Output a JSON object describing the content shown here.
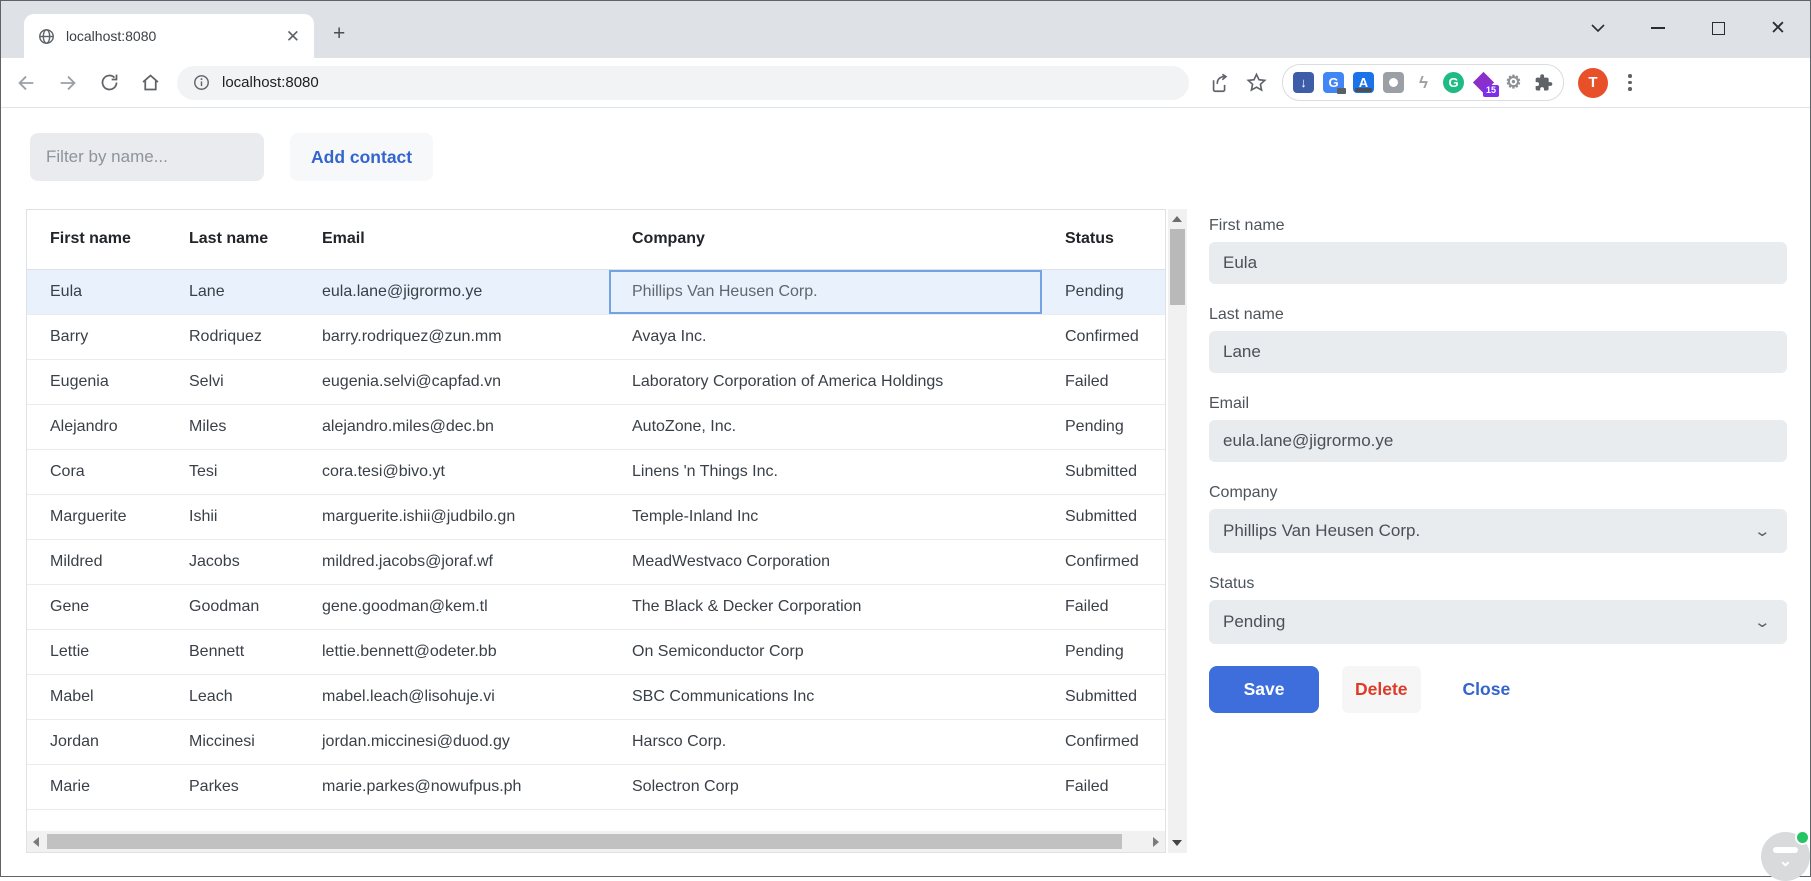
{
  "browser": {
    "tab_title": "localhost:8080",
    "url": "localhost:8080",
    "extensions_badge": "15",
    "avatar_letter": "T"
  },
  "actions": {
    "filter_placeholder": "Filter by name...",
    "add_contact": "Add contact"
  },
  "table": {
    "columns": [
      "First name",
      "Last name",
      "Email",
      "Company",
      "Status"
    ],
    "selected_row_index": 0,
    "focused_cell": {
      "row": 0,
      "column": "company"
    },
    "rows": [
      {
        "first": "Eula",
        "last": "Lane",
        "email": "eula.lane@jigrormo.ye",
        "company": "Phillips Van Heusen Corp.",
        "status": "Pending"
      },
      {
        "first": "Barry",
        "last": "Rodriquez",
        "email": "barry.rodriquez@zun.mm",
        "company": "Avaya Inc.",
        "status": "Confirmed"
      },
      {
        "first": "Eugenia",
        "last": "Selvi",
        "email": "eugenia.selvi@capfad.vn",
        "company": "Laboratory Corporation of America Holdings",
        "status": "Failed"
      },
      {
        "first": "Alejandro",
        "last": "Miles",
        "email": "alejandro.miles@dec.bn",
        "company": "AutoZone, Inc.",
        "status": "Pending"
      },
      {
        "first": "Cora",
        "last": "Tesi",
        "email": "cora.tesi@bivo.yt",
        "company": "Linens 'n Things Inc.",
        "status": "Submitted"
      },
      {
        "first": "Marguerite",
        "last": "Ishii",
        "email": "marguerite.ishii@judbilo.gn",
        "company": "Temple-Inland Inc",
        "status": "Submitted"
      },
      {
        "first": "Mildred",
        "last": "Jacobs",
        "email": "mildred.jacobs@joraf.wf",
        "company": "MeadWestvaco Corporation",
        "status": "Confirmed"
      },
      {
        "first": "Gene",
        "last": "Goodman",
        "email": "gene.goodman@kem.tl",
        "company": "The Black & Decker Corporation",
        "status": "Failed"
      },
      {
        "first": "Lettie",
        "last": "Bennett",
        "email": "lettie.bennett@odeter.bb",
        "company": "On Semiconductor Corp",
        "status": "Pending"
      },
      {
        "first": "Mabel",
        "last": "Leach",
        "email": "mabel.leach@lisohuje.vi",
        "company": "SBC Communications Inc",
        "status": "Submitted"
      },
      {
        "first": "Jordan",
        "last": "Miccinesi",
        "email": "jordan.miccinesi@duod.gy",
        "company": "Harsco Corp.",
        "status": "Confirmed"
      },
      {
        "first": "Marie",
        "last": "Parkes",
        "email": "marie.parkes@nowufpus.ph",
        "company": "Solectron Corp",
        "status": "Failed"
      }
    ]
  },
  "form": {
    "first_name": {
      "label": "First name",
      "value": "Eula"
    },
    "last_name": {
      "label": "Last name",
      "value": "Lane"
    },
    "email": {
      "label": "Email",
      "value": "eula.lane@jigrormo.ye"
    },
    "company": {
      "label": "Company",
      "value": "Phillips Van Heusen Corp."
    },
    "status": {
      "label": "Status",
      "value": "Pending"
    },
    "buttons": {
      "save": "Save",
      "delete": "Delete",
      "close": "Close"
    }
  },
  "colors": {
    "titlebar": "#dee1e6",
    "accent_blue": "#3464cf",
    "save_blue": "#3d6edb",
    "delete_red": "#dd3b27",
    "selected_row": "#e9f1fd",
    "focus_border": "#74a3e3",
    "input_bg": "#e9ecef"
  }
}
